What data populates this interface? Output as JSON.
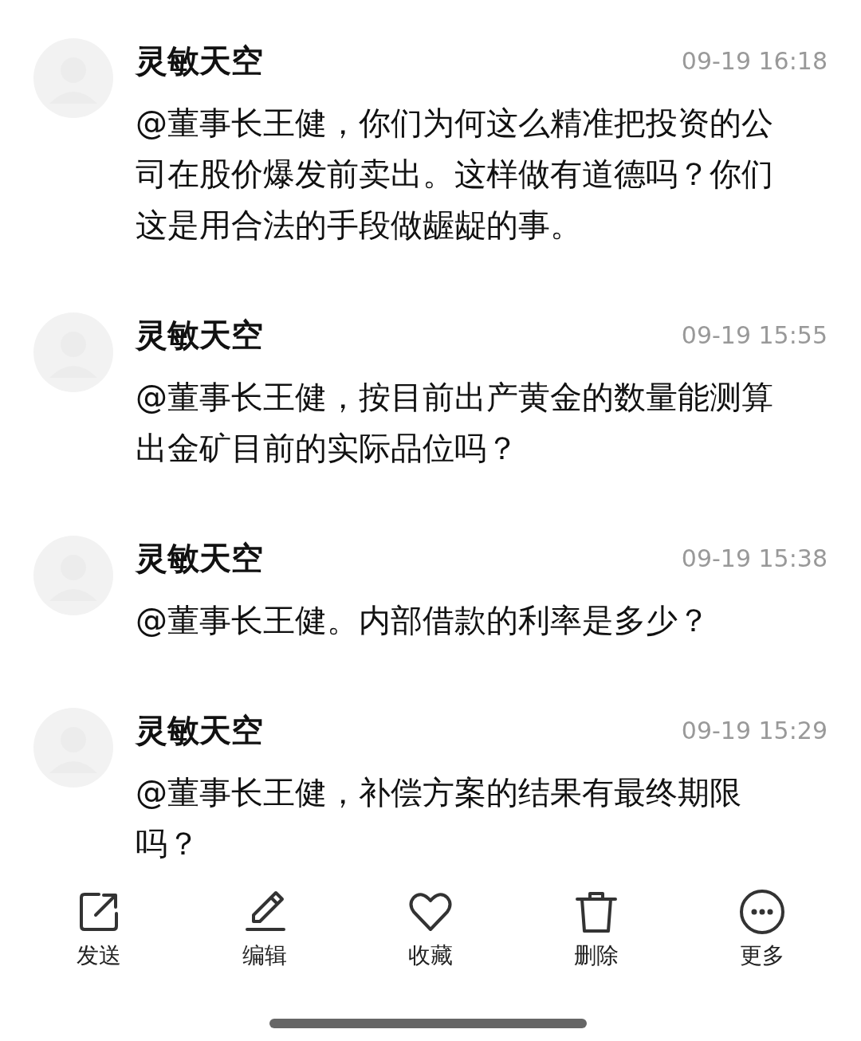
{
  "comments": [
    {
      "name": "灵敏天空",
      "time": "09-19 16:18",
      "text": "@董事长王健，你们为何这么精准把投资的公司在股价爆发前卖出。这样做有道德吗？你们这是用合法的手段做龌龊的事。"
    },
    {
      "name": "灵敏天空",
      "time": "09-19 15:55",
      "text": "@董事长王健，按目前出产黄金的数量能测算出金矿目前的实际品位吗？"
    },
    {
      "name": "灵敏天空",
      "time": "09-19 15:38",
      "text": "@董事长王健。内部借款的利率是多少？"
    },
    {
      "name": "灵敏天空",
      "time": "09-19 15:29",
      "text": "@董事长王健，补偿方案的结果有最终期限吗？"
    }
  ],
  "toolbar": [
    {
      "kind": "send",
      "label": "发送"
    },
    {
      "kind": "edit",
      "label": "编辑"
    },
    {
      "kind": "favorite",
      "label": "收藏"
    },
    {
      "kind": "delete",
      "label": "删除"
    },
    {
      "kind": "more",
      "label": "更多"
    }
  ]
}
